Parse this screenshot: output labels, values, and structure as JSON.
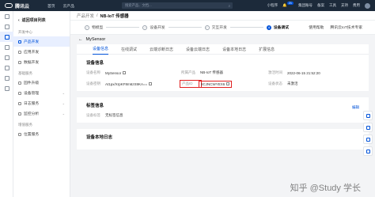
{
  "topbar": {
    "brand": "腾讯云",
    "home": "首页",
    "products": "云产品",
    "search_placeholder": "搜索产品、文档...",
    "mini_program": "小程序",
    "notif_count": "21",
    "right_links": [
      "集团账号",
      "备案",
      "工具",
      "支持",
      "费用"
    ]
  },
  "sidenav": {
    "back_label": "返回项目列表",
    "groups": [
      {
        "title": "开发中心",
        "items": [
          "产品开发",
          "应用开发",
          "数据开发"
        ]
      },
      {
        "title": "基础服务",
        "items": [
          "固件升级",
          "设备管理",
          "日志服务",
          "监控分析"
        ]
      },
      {
        "title": "增值服务",
        "items": [
          "位置服务"
        ]
      }
    ]
  },
  "breadcrumb": {
    "parent": "产品开发",
    "sep": "/",
    "current": "NB-IoT 传感器"
  },
  "steps": [
    {
      "num": "✓",
      "label": "物模型"
    },
    {
      "num": "✓",
      "label": "设备开发"
    },
    {
      "num": "✓",
      "label": "交互开发"
    },
    {
      "num": "4",
      "label": "设备调试"
    }
  ],
  "step_extra": [
    "使用帮助",
    "腾讯云IoT技术专家"
  ],
  "device": {
    "name": "MySensor"
  },
  "tabs": [
    "设备信息",
    "在线调试",
    "云端诊断日志",
    "设备云端日志",
    "设备本地日志",
    "扩展信息"
  ],
  "info": {
    "title": "设备信息",
    "fields": [
      {
        "k": "设备名称",
        "v": "MySensor"
      },
      {
        "k": "所属产品",
        "v": "NB-IoT 传感器"
      },
      {
        "k": "激活时间",
        "v": "2022-06-15 21:52:20"
      },
      {
        "k": "设备密钥",
        "v": "At1px/XrpKF8m6zS9KA=="
      },
      {
        "k": "产品ID",
        "v": "6CJNCWYEX6"
      },
      {
        "k": "设备状态",
        "v": "未激活"
      }
    ]
  },
  "tags": {
    "title": "标签信息",
    "edit": "编辑",
    "label": "设备标签",
    "value": "无标签信息"
  },
  "local": {
    "title": "设备本地日志"
  },
  "watermark": "知乎 @Study 学长"
}
